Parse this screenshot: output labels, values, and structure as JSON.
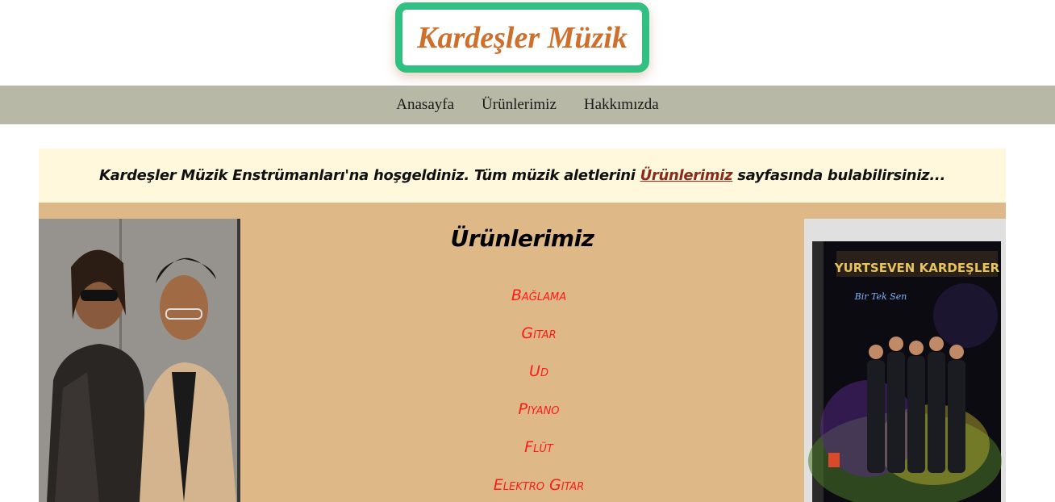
{
  "header": {
    "logo_text": "Kardeşler Müzik"
  },
  "nav": {
    "items": [
      {
        "label": "Anasayfa"
      },
      {
        "label": "Ürünlerimiz"
      },
      {
        "label": "Hakkımızda"
      }
    ]
  },
  "welcome": {
    "text_before": "Kardeşler Müzik Enstrümanları'na hoşgeldiniz. Tüm müzik aletlerini ",
    "link_text": "Ürünlerimiz",
    "text_after": " sayfasında bulabilirsiniz..."
  },
  "products": {
    "title": "Ürünlerimiz",
    "items": [
      {
        "label": "Bağlama"
      },
      {
        "label": "Gitar"
      },
      {
        "label": "Ud"
      },
      {
        "label": "Piyano"
      },
      {
        "label": "Flüt"
      },
      {
        "label": "Elektro Gitar"
      }
    ]
  },
  "album": {
    "title_text": "YURTSEVEN KARDEŞLER",
    "subtitle_text": "Bir Tek Sen"
  },
  "colors": {
    "logo_border": "#32bf82",
    "logo_text": "#cf6f2c",
    "navbar": "#b8b8a6",
    "welcome_bg": "#fff8dc",
    "content_bg": "#deb887",
    "product_link": "#ff1a1a"
  }
}
